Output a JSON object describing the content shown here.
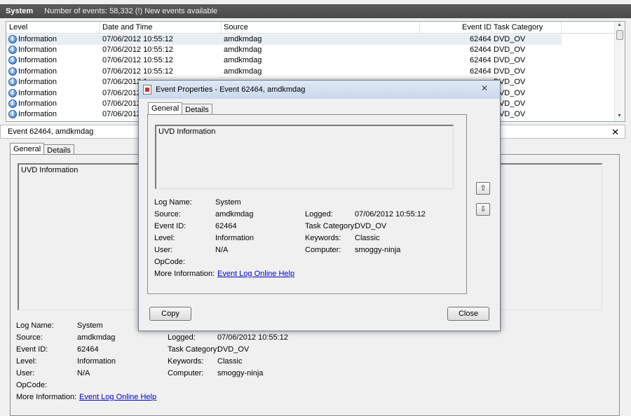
{
  "titlebar": {
    "log": "System",
    "summary": "Number of events: 58,332 (!) New events available"
  },
  "grid": {
    "headers": {
      "level": "Level",
      "date": "Date and Time",
      "source": "Source",
      "event_id": "Event ID",
      "task": "Task Category"
    },
    "rows": [
      {
        "level": "Information",
        "date": "07/06/2012 10:55:12",
        "source": "amdkmdag",
        "event_id": "62464",
        "task": "DVD_OV"
      },
      {
        "level": "Information",
        "date": "07/06/2012 10:55:12",
        "source": "amdkmdag",
        "event_id": "62464",
        "task": "DVD_OV"
      },
      {
        "level": "Information",
        "date": "07/06/2012 10:55:12",
        "source": "amdkmdag",
        "event_id": "62464",
        "task": "DVD_OV"
      },
      {
        "level": "Information",
        "date": "07/06/2012 10:55:12",
        "source": "amdkmdag",
        "event_id": "62464",
        "task": "DVD_OV"
      },
      {
        "level": "Information",
        "date": "07/06/2012 1",
        "source": "",
        "event_id": "",
        "task": "DVD_OV"
      },
      {
        "level": "Information",
        "date": "07/06/2012 1",
        "source": "",
        "event_id": "",
        "task": "DVD_OV"
      },
      {
        "level": "Information",
        "date": "07/06/2012 1",
        "source": "",
        "event_id": "",
        "task": "DVD_OV"
      },
      {
        "level": "Information",
        "date": "07/06/2012 1",
        "source": "",
        "event_id": "",
        "task": "DVD_OV"
      }
    ]
  },
  "detail": {
    "title": "Event 62464, amdkmdag",
    "tabs": [
      "General",
      "Details"
    ],
    "description": "UVD Information",
    "fields": {
      "log_name_label": "Log Name:",
      "log_name": "System",
      "source_label": "Source:",
      "source": "amdkmdag",
      "logged_label": "Logged:",
      "logged": "07/06/2012 10:55:12",
      "event_id_label": "Event ID:",
      "event_id": "62464",
      "task_label": "Task Category:",
      "task": "DVD_OV",
      "level_label": "Level:",
      "level": "Information",
      "keywords_label": "Keywords:",
      "keywords": "Classic",
      "user_label": "User:",
      "user": "N/A",
      "computer_label": "Computer:",
      "computer": "smoggy-ninja",
      "opcode_label": "OpCode:",
      "more_info_label": "More Information:",
      "more_info_link": "Event Log Online Help"
    }
  },
  "dialog": {
    "title": "Event Properties - Event 62464, amdkmdag",
    "close_glyph": "✕",
    "copy_label": "Copy",
    "close_label": "Close",
    "up_glyph": "⇧",
    "down_glyph": "⇩"
  },
  "glyphs": {
    "info": "i",
    "close_x": "✕",
    "scroll_up": "▲",
    "scroll_down": "▼"
  }
}
